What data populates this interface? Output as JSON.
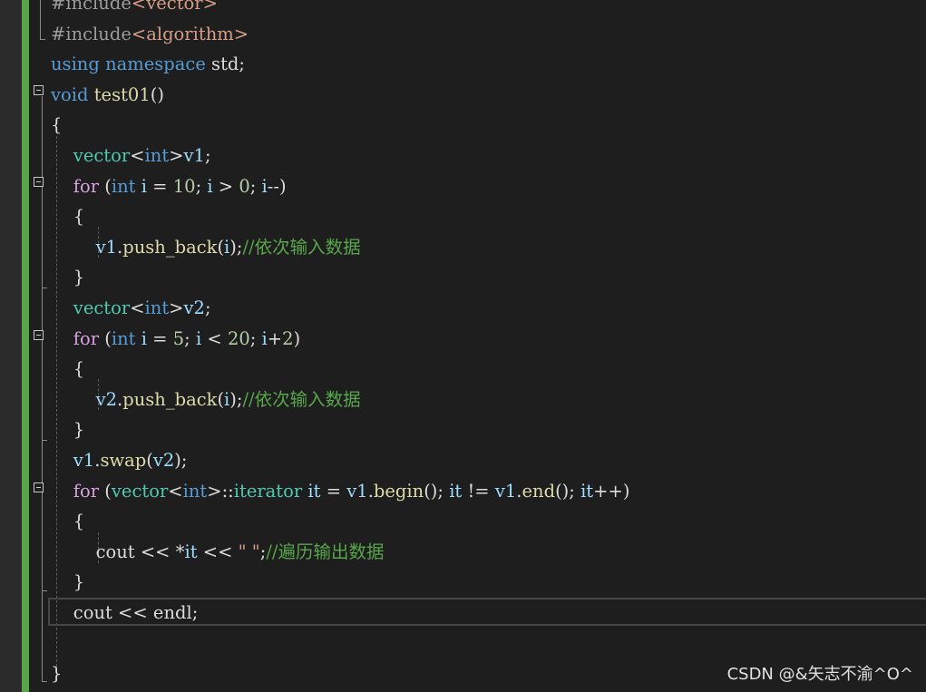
{
  "colors": {
    "background": "#1e1e1e",
    "change_bar": "#57a64a",
    "keyword": "#569cd6",
    "control": "#d8a0df",
    "type": "#4ec9b0",
    "function": "#dcdcaa",
    "variable": "#9cdcfe",
    "number": "#b5cea8",
    "string": "#d69d85",
    "comment": "#57a64a",
    "text": "#dcdcdc"
  },
  "code": {
    "lines": [
      [
        {
          "t": "#include",
          "c": "#9b9b9b"
        },
        {
          "t": "<vector>",
          "c": "#d69d85"
        }
      ],
      [
        {
          "t": "#include",
          "c": "#9b9b9b"
        },
        {
          "t": "<algorithm>",
          "c": "#d69d85"
        }
      ],
      [
        {
          "t": "using",
          "c": "#569cd6"
        },
        {
          "t": " ",
          "c": "#dcdcdc"
        },
        {
          "t": "namespace",
          "c": "#569cd6"
        },
        {
          "t": " std;",
          "c": "#dcdcdc"
        }
      ],
      [
        {
          "t": "void",
          "c": "#569cd6"
        },
        {
          "t": " ",
          "c": "#dcdcdc"
        },
        {
          "t": "test01",
          "c": "#dcdcaa"
        },
        {
          "t": "()",
          "c": "#dcdcdc"
        }
      ],
      [
        {
          "t": "{",
          "c": "#dcdcdc"
        }
      ],
      [
        {
          "t": "    ",
          "c": "#dcdcdc"
        },
        {
          "t": "vector",
          "c": "#4ec9b0"
        },
        {
          "t": "<",
          "c": "#dcdcdc"
        },
        {
          "t": "int",
          "c": "#569cd6"
        },
        {
          "t": ">",
          "c": "#dcdcdc"
        },
        {
          "t": "v1",
          "c": "#9cdcfe"
        },
        {
          "t": ";",
          "c": "#dcdcdc"
        }
      ],
      [
        {
          "t": "    ",
          "c": "#dcdcdc"
        },
        {
          "t": "for",
          "c": "#d8a0df"
        },
        {
          "t": " (",
          "c": "#dcdcdc"
        },
        {
          "t": "int",
          "c": "#569cd6"
        },
        {
          "t": " ",
          "c": "#dcdcdc"
        },
        {
          "t": "i",
          "c": "#9cdcfe"
        },
        {
          "t": " = ",
          "c": "#dcdcdc"
        },
        {
          "t": "10",
          "c": "#b5cea8"
        },
        {
          "t": "; ",
          "c": "#dcdcdc"
        },
        {
          "t": "i",
          "c": "#9cdcfe"
        },
        {
          "t": " > ",
          "c": "#dcdcdc"
        },
        {
          "t": "0",
          "c": "#b5cea8"
        },
        {
          "t": "; ",
          "c": "#dcdcdc"
        },
        {
          "t": "i",
          "c": "#9cdcfe"
        },
        {
          "t": "--)",
          "c": "#dcdcdc"
        }
      ],
      [
        {
          "t": "    {",
          "c": "#dcdcdc"
        }
      ],
      [
        {
          "t": "        ",
          "c": "#dcdcdc"
        },
        {
          "t": "v1",
          "c": "#9cdcfe"
        },
        {
          "t": ".",
          "c": "#dcdcdc"
        },
        {
          "t": "push_back",
          "c": "#dcdcaa"
        },
        {
          "t": "(",
          "c": "#dcdcdc"
        },
        {
          "t": "i",
          "c": "#9cdcfe"
        },
        {
          "t": ");",
          "c": "#dcdcdc"
        },
        {
          "t": "//依次输入数据",
          "c": "#57a64a"
        }
      ],
      [
        {
          "t": "    }",
          "c": "#dcdcdc"
        }
      ],
      [
        {
          "t": "    ",
          "c": "#dcdcdc"
        },
        {
          "t": "vector",
          "c": "#4ec9b0"
        },
        {
          "t": "<",
          "c": "#dcdcdc"
        },
        {
          "t": "int",
          "c": "#569cd6"
        },
        {
          "t": ">",
          "c": "#dcdcdc"
        },
        {
          "t": "v2",
          "c": "#9cdcfe"
        },
        {
          "t": ";",
          "c": "#dcdcdc"
        }
      ],
      [
        {
          "t": "    ",
          "c": "#dcdcdc"
        },
        {
          "t": "for",
          "c": "#d8a0df"
        },
        {
          "t": " (",
          "c": "#dcdcdc"
        },
        {
          "t": "int",
          "c": "#569cd6"
        },
        {
          "t": " ",
          "c": "#dcdcdc"
        },
        {
          "t": "i",
          "c": "#9cdcfe"
        },
        {
          "t": " = ",
          "c": "#dcdcdc"
        },
        {
          "t": "5",
          "c": "#b5cea8"
        },
        {
          "t": "; ",
          "c": "#dcdcdc"
        },
        {
          "t": "i",
          "c": "#9cdcfe"
        },
        {
          "t": " < ",
          "c": "#dcdcdc"
        },
        {
          "t": "20",
          "c": "#b5cea8"
        },
        {
          "t": "; ",
          "c": "#dcdcdc"
        },
        {
          "t": "i",
          "c": "#9cdcfe"
        },
        {
          "t": "+",
          "c": "#dcdcdc"
        },
        {
          "t": "2",
          "c": "#b5cea8"
        },
        {
          "t": ")",
          "c": "#dcdcdc"
        }
      ],
      [
        {
          "t": "    {",
          "c": "#dcdcdc"
        }
      ],
      [
        {
          "t": "        ",
          "c": "#dcdcdc"
        },
        {
          "t": "v2",
          "c": "#9cdcfe"
        },
        {
          "t": ".",
          "c": "#dcdcdc"
        },
        {
          "t": "push_back",
          "c": "#dcdcaa"
        },
        {
          "t": "(",
          "c": "#dcdcdc"
        },
        {
          "t": "i",
          "c": "#9cdcfe"
        },
        {
          "t": ");",
          "c": "#dcdcdc"
        },
        {
          "t": "//依次输入数据",
          "c": "#57a64a"
        }
      ],
      [
        {
          "t": "    }",
          "c": "#dcdcdc"
        }
      ],
      [
        {
          "t": "    ",
          "c": "#dcdcdc"
        },
        {
          "t": "v1",
          "c": "#9cdcfe"
        },
        {
          "t": ".",
          "c": "#dcdcdc"
        },
        {
          "t": "swap",
          "c": "#dcdcaa"
        },
        {
          "t": "(",
          "c": "#dcdcdc"
        },
        {
          "t": "v2",
          "c": "#9cdcfe"
        },
        {
          "t": ");",
          "c": "#dcdcdc"
        }
      ],
      [
        {
          "t": "    ",
          "c": "#dcdcdc"
        },
        {
          "t": "for",
          "c": "#d8a0df"
        },
        {
          "t": " (",
          "c": "#dcdcdc"
        },
        {
          "t": "vector",
          "c": "#4ec9b0"
        },
        {
          "t": "<",
          "c": "#dcdcdc"
        },
        {
          "t": "int",
          "c": "#569cd6"
        },
        {
          "t": ">::",
          "c": "#dcdcdc"
        },
        {
          "t": "iterator",
          "c": "#4ec9b0"
        },
        {
          "t": " ",
          "c": "#dcdcdc"
        },
        {
          "t": "it",
          "c": "#9cdcfe"
        },
        {
          "t": " = ",
          "c": "#dcdcdc"
        },
        {
          "t": "v1",
          "c": "#9cdcfe"
        },
        {
          "t": ".",
          "c": "#dcdcdc"
        },
        {
          "t": "begin",
          "c": "#dcdcaa"
        },
        {
          "t": "(); ",
          "c": "#dcdcdc"
        },
        {
          "t": "it",
          "c": "#9cdcfe"
        },
        {
          "t": " != ",
          "c": "#dcdcdc"
        },
        {
          "t": "v1",
          "c": "#9cdcfe"
        },
        {
          "t": ".",
          "c": "#dcdcdc"
        },
        {
          "t": "end",
          "c": "#dcdcaa"
        },
        {
          "t": "(); ",
          "c": "#dcdcdc"
        },
        {
          "t": "it",
          "c": "#9cdcfe"
        },
        {
          "t": "++)",
          "c": "#dcdcdc"
        }
      ],
      [
        {
          "t": "    {",
          "c": "#dcdcdc"
        }
      ],
      [
        {
          "t": "        cout << *",
          "c": "#dcdcdc"
        },
        {
          "t": "it",
          "c": "#9cdcfe"
        },
        {
          "t": " << ",
          "c": "#dcdcdc"
        },
        {
          "t": "\" \"",
          "c": "#d69d85"
        },
        {
          "t": ";",
          "c": "#dcdcdc"
        },
        {
          "t": "//遍历输出数据",
          "c": "#57a64a"
        }
      ],
      [
        {
          "t": "    }",
          "c": "#dcdcdc"
        }
      ],
      [
        {
          "t": "    cout << endl;",
          "c": "#dcdcdc"
        }
      ],
      [
        {
          "t": "",
          "c": "#dcdcdc"
        }
      ],
      [
        {
          "t": "}",
          "c": "#dcdcdc"
        }
      ]
    ]
  },
  "watermark": "CSDN @&矢志不渝^O^"
}
